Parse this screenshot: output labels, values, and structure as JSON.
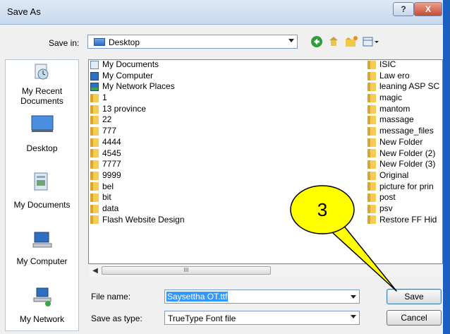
{
  "window": {
    "title": "Save As",
    "help_glyph": "?",
    "close_glyph": "X"
  },
  "toolbar": {
    "save_in_label": "Save in:",
    "location": "Desktop",
    "icons": [
      "back-arrow-icon",
      "up-folder-icon",
      "new-folder-icon",
      "views-menu-icon"
    ]
  },
  "places": [
    {
      "label": "My Recent Documents",
      "icon": "recent-documents-icon"
    },
    {
      "label": "Desktop",
      "icon": "desktop-icon"
    },
    {
      "label": "My Documents",
      "icon": "my-documents-icon"
    },
    {
      "label": "My Computer",
      "icon": "my-computer-icon"
    },
    {
      "label": "My Network",
      "icon": "my-network-icon"
    }
  ],
  "files": {
    "column1": [
      {
        "name": "My Documents",
        "icon": "documents-icon"
      },
      {
        "name": "My Computer",
        "icon": "computer-icon"
      },
      {
        "name": "My Network Places",
        "icon": "network-icon"
      },
      {
        "name": "1",
        "icon": "folder-icon"
      },
      {
        "name": "13 province",
        "icon": "folder-icon"
      },
      {
        "name": "22",
        "icon": "folder-icon"
      },
      {
        "name": "777",
        "icon": "folder-icon"
      },
      {
        "name": "4444",
        "icon": "folder-icon"
      },
      {
        "name": "4545",
        "icon": "folder-icon"
      },
      {
        "name": "7777",
        "icon": "folder-icon"
      },
      {
        "name": "9999",
        "icon": "folder-icon"
      },
      {
        "name": "bel",
        "icon": "folder-icon"
      },
      {
        "name": "bit",
        "icon": "folder-icon"
      },
      {
        "name": "data",
        "icon": "folder-icon"
      },
      {
        "name": "Flash Website Design",
        "icon": "folder-icon"
      }
    ],
    "column2": [
      {
        "name": "ISIC",
        "icon": "folder-icon"
      },
      {
        "name": "Law ero",
        "icon": "folder-icon"
      },
      {
        "name": "leaning ASP SC",
        "icon": "folder-icon"
      },
      {
        "name": "magic",
        "icon": "folder-icon"
      },
      {
        "name": "mantom",
        "icon": "folder-icon"
      },
      {
        "name": "massage",
        "icon": "folder-icon"
      },
      {
        "name": "message_files",
        "icon": "folder-icon"
      },
      {
        "name": "New Folder",
        "icon": "folder-icon"
      },
      {
        "name": "New Folder (2)",
        "icon": "folder-icon"
      },
      {
        "name": "New Folder (3)",
        "icon": "folder-icon"
      },
      {
        "name": "Original",
        "icon": "folder-icon"
      },
      {
        "name": "picture for prin",
        "icon": "folder-icon"
      },
      {
        "name": "post",
        "icon": "folder-icon"
      },
      {
        "name": "psv",
        "icon": "folder-icon"
      },
      {
        "name": "Restore FF Hid",
        "icon": "folder-icon"
      }
    ]
  },
  "scrollbar": {
    "left_arrow": "◀",
    "grip": "III"
  },
  "form": {
    "file_name_label": "File name:",
    "file_name_value": "Saysettha OT.ttf",
    "save_as_type_label": "Save as type:",
    "save_as_type_value": "TrueType Font file"
  },
  "buttons": {
    "save": "Save",
    "cancel": "Cancel"
  },
  "callout": {
    "text": "3",
    "fill": "#ffff00"
  },
  "colors": {
    "selection": "#3399ff",
    "sidebar_border": "#b7c4d6",
    "accent_bar": "#1d5fc0"
  }
}
